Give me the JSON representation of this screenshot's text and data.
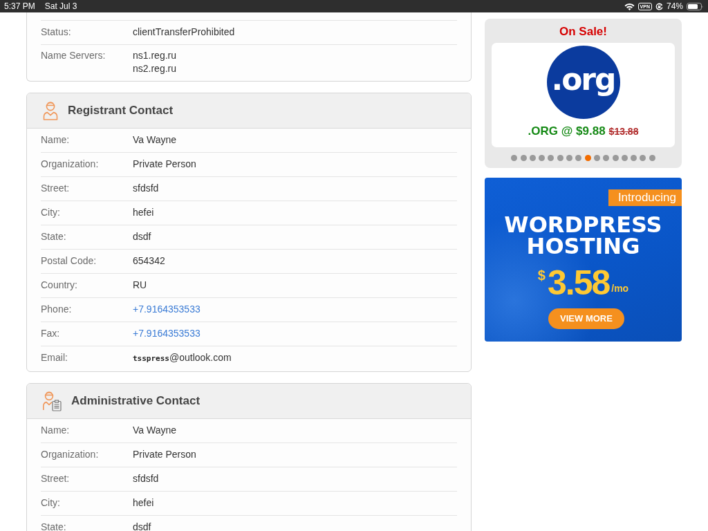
{
  "status_bar": {
    "time": "5:37 PM",
    "date": "Sat Jul 3",
    "vpn": "VPN",
    "battery": "74%"
  },
  "domain_card": {
    "rows": [
      {
        "label": "Status:",
        "kind": "text",
        "value": "clientTransferProhibited"
      },
      {
        "label": "Name Servers:",
        "kind": "lines",
        "values": [
          "ns1.reg.ru",
          "ns2.reg.ru"
        ]
      }
    ]
  },
  "contacts": [
    {
      "title": "Registrant Contact",
      "kind": "person",
      "rows": [
        {
          "label": "Name:",
          "kind": "text",
          "value": "Va Wayne"
        },
        {
          "label": "Organization:",
          "kind": "text",
          "value": "Private Person"
        },
        {
          "label": "Street:",
          "kind": "text",
          "value": "sfdsfd"
        },
        {
          "label": "City:",
          "kind": "text",
          "value": "hefei"
        },
        {
          "label": "State:",
          "kind": "text",
          "value": "dsdf"
        },
        {
          "label": "Postal Code:",
          "kind": "text",
          "value": "654342"
        },
        {
          "label": "Country:",
          "kind": "text",
          "value": "RU"
        },
        {
          "label": "Phone:",
          "kind": "link",
          "value": "+7.9164353533"
        },
        {
          "label": "Fax:",
          "kind": "link",
          "value": "+7.9164353533"
        },
        {
          "label": "Email:",
          "kind": "text",
          "value": "**tsspress**@outlook.com"
        }
      ]
    },
    {
      "title": "Administrative Contact",
      "kind": "admin",
      "rows": [
        {
          "label": "Name:",
          "kind": "text",
          "value": "Va Wayne"
        },
        {
          "label": "Organization:",
          "kind": "text",
          "value": "Private Person"
        },
        {
          "label": "Street:",
          "kind": "text",
          "value": "sfdsfd"
        },
        {
          "label": "City:",
          "kind": "text",
          "value": "hefei"
        },
        {
          "label": "State:",
          "kind": "text",
          "value": "dsdf"
        }
      ]
    }
  ],
  "sale": {
    "heading": "On Sale!",
    "logo_text": ".org",
    "offer": ".ORG @ $9.88",
    "old_price": "$13.88",
    "dots": [
      {
        "selected": false
      },
      {
        "selected": false
      },
      {
        "selected": false
      },
      {
        "selected": false
      },
      {
        "selected": false
      },
      {
        "selected": false
      },
      {
        "selected": false
      },
      {
        "selected": false
      },
      {
        "selected": true
      },
      {
        "selected": false
      },
      {
        "selected": false
      },
      {
        "selected": false
      },
      {
        "selected": false
      },
      {
        "selected": false
      },
      {
        "selected": false
      },
      {
        "selected": false
      }
    ]
  },
  "banner": {
    "ribbon": "Introducing",
    "title_lines": [
      "WORDPRESS",
      "HOSTING"
    ],
    "currency": "$",
    "price": "3.58",
    "unit": "/mo",
    "button": "VIEW MORE"
  }
}
